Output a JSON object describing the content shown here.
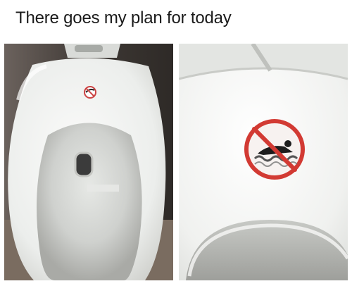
{
  "meme": {
    "caption": "There goes my plan for today"
  },
  "colors": {
    "background": "#ffffff",
    "porcelain": "#f1f2f0",
    "shadow": "#c9c8c3",
    "wall": "#4a4440",
    "sign_red": "#d23a33"
  },
  "icons": {
    "sign": "no-swimming-icon"
  }
}
